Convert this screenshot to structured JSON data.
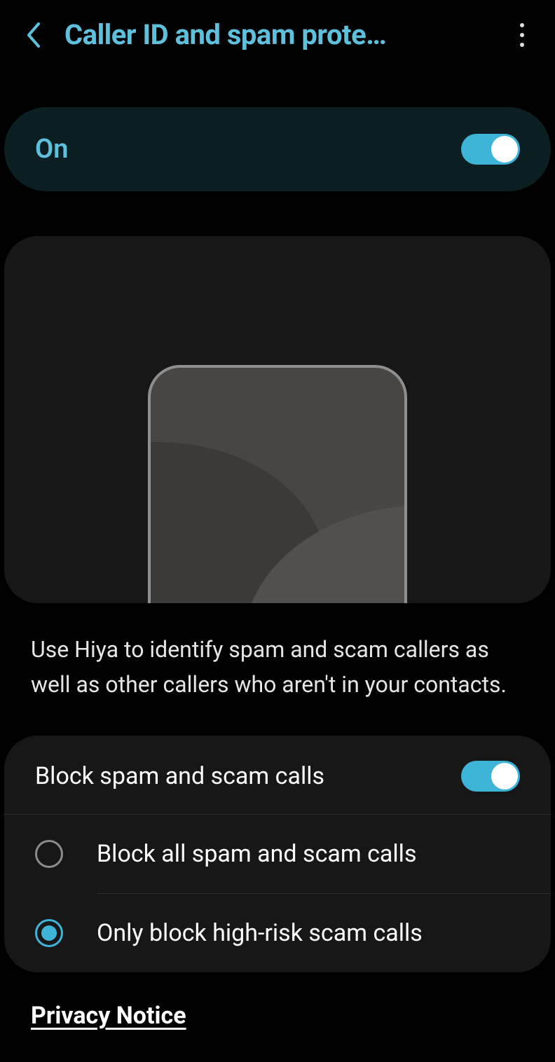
{
  "header": {
    "title": "Caller ID and spam prote…"
  },
  "master": {
    "label": "On",
    "enabled": true
  },
  "description": "Use Hiya to identify spam and scam callers as well as other callers who aren't in your contacts.",
  "block": {
    "label": "Block spam and scam calls",
    "enabled": true,
    "options": [
      {
        "label": "Block all spam and scam calls",
        "selected": false
      },
      {
        "label": "Only block high-risk scam calls",
        "selected": true
      }
    ]
  },
  "privacy_link": "Privacy Notice"
}
